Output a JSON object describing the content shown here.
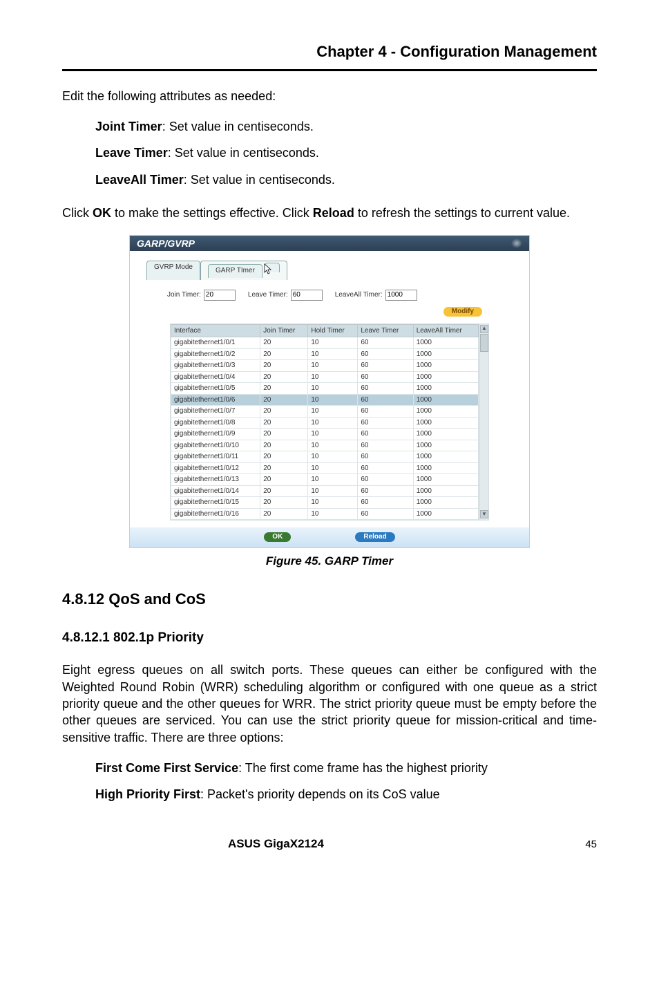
{
  "chapter": "Chapter 4 - Configuration Management",
  "intro": "Edit the following attributes as needed:",
  "attrs": [
    {
      "label": "Joint Timer",
      "desc": ": Set value in centiseconds."
    },
    {
      "label": "Leave Timer",
      "desc": ": Set value in centiseconds."
    },
    {
      "label": "LeaveAll Timer",
      "desc": ": Set value in centiseconds."
    }
  ],
  "click_para_1": "Click ",
  "click_ok": "OK",
  "click_para_2": " to make the settings effective. Click ",
  "click_reload": "Reload",
  "click_para_3": " to refresh the settings to current value.",
  "figure": {
    "title": "GARP/GVRP",
    "tabs": {
      "inactive": "GVRP Mode",
      "active": "GARP TImer"
    },
    "timers": {
      "join_label": "Join Timer:",
      "join_value": "20",
      "leave_label": "Leave Timer:",
      "leave_value": "60",
      "leaveall_label": "LeaveAll Timer:",
      "leaveall_value": "1000"
    },
    "modify": "Modify",
    "headers": {
      "iface": "Interface",
      "join": "Join Timer",
      "hold": "Hold Timer",
      "leave": "Leave Timer",
      "leaveall": "LeaveAll Timer"
    },
    "rows": [
      {
        "iface": "gigabitethernet1/0/1",
        "join": "20",
        "hold": "10",
        "leave": "60",
        "leaveall": "1000",
        "hl": false
      },
      {
        "iface": "gigabitethernet1/0/2",
        "join": "20",
        "hold": "10",
        "leave": "60",
        "leaveall": "1000",
        "hl": false
      },
      {
        "iface": "gigabitethernet1/0/3",
        "join": "20",
        "hold": "10",
        "leave": "60",
        "leaveall": "1000",
        "hl": false
      },
      {
        "iface": "gigabitethernet1/0/4",
        "join": "20",
        "hold": "10",
        "leave": "60",
        "leaveall": "1000",
        "hl": false
      },
      {
        "iface": "gigabitethernet1/0/5",
        "join": "20",
        "hold": "10",
        "leave": "60",
        "leaveall": "1000",
        "hl": false
      },
      {
        "iface": "gigabitethernet1/0/6",
        "join": "20",
        "hold": "10",
        "leave": "60",
        "leaveall": "1000",
        "hl": true
      },
      {
        "iface": "gigabitethernet1/0/7",
        "join": "20",
        "hold": "10",
        "leave": "60",
        "leaveall": "1000",
        "hl": false
      },
      {
        "iface": "gigabitethernet1/0/8",
        "join": "20",
        "hold": "10",
        "leave": "60",
        "leaveall": "1000",
        "hl": false
      },
      {
        "iface": "gigabitethernet1/0/9",
        "join": "20",
        "hold": "10",
        "leave": "60",
        "leaveall": "1000",
        "hl": false
      },
      {
        "iface": "gigabitethernet1/0/10",
        "join": "20",
        "hold": "10",
        "leave": "60",
        "leaveall": "1000",
        "hl": false
      },
      {
        "iface": "gigabitethernet1/0/11",
        "join": "20",
        "hold": "10",
        "leave": "60",
        "leaveall": "1000",
        "hl": false
      },
      {
        "iface": "gigabitethernet1/0/12",
        "join": "20",
        "hold": "10",
        "leave": "60",
        "leaveall": "1000",
        "hl": false
      },
      {
        "iface": "gigabitethernet1/0/13",
        "join": "20",
        "hold": "10",
        "leave": "60",
        "leaveall": "1000",
        "hl": false
      },
      {
        "iface": "gigabitethernet1/0/14",
        "join": "20",
        "hold": "10",
        "leave": "60",
        "leaveall": "1000",
        "hl": false
      },
      {
        "iface": "gigabitethernet1/0/15",
        "join": "20",
        "hold": "10",
        "leave": "60",
        "leaveall": "1000",
        "hl": false
      },
      {
        "iface": "gigabitethernet1/0/16",
        "join": "20",
        "hold": "10",
        "leave": "60",
        "leaveall": "1000",
        "hl": false
      }
    ],
    "ok": "OK",
    "reload": "Reload",
    "caption": "Figure 45. GARP Timer"
  },
  "section_4_8_12": "4.8.12  QoS and CoS",
  "section_4_8_12_1": "4.8.12.1 802.1p Priority",
  "para2": "Eight egress queues on all switch ports. These queues can either be configured with the Weighted Round Robin (WRR) scheduling algorithm or configured with one queue as a strict priority queue and the other queues for WRR. The strict priority queue must be empty before the other queues are serviced. You can use the strict priority queue for mission-critical and time-sensitive traffic. There are three options:",
  "opts": [
    {
      "label": "First Come First Service",
      "desc": ": The first come frame has the highest priority"
    },
    {
      "label": "High Priority First",
      "desc": ": Packet's priority depends on its CoS value"
    }
  ],
  "footer": {
    "product": "ASUS GigaX2124",
    "page": "45"
  }
}
